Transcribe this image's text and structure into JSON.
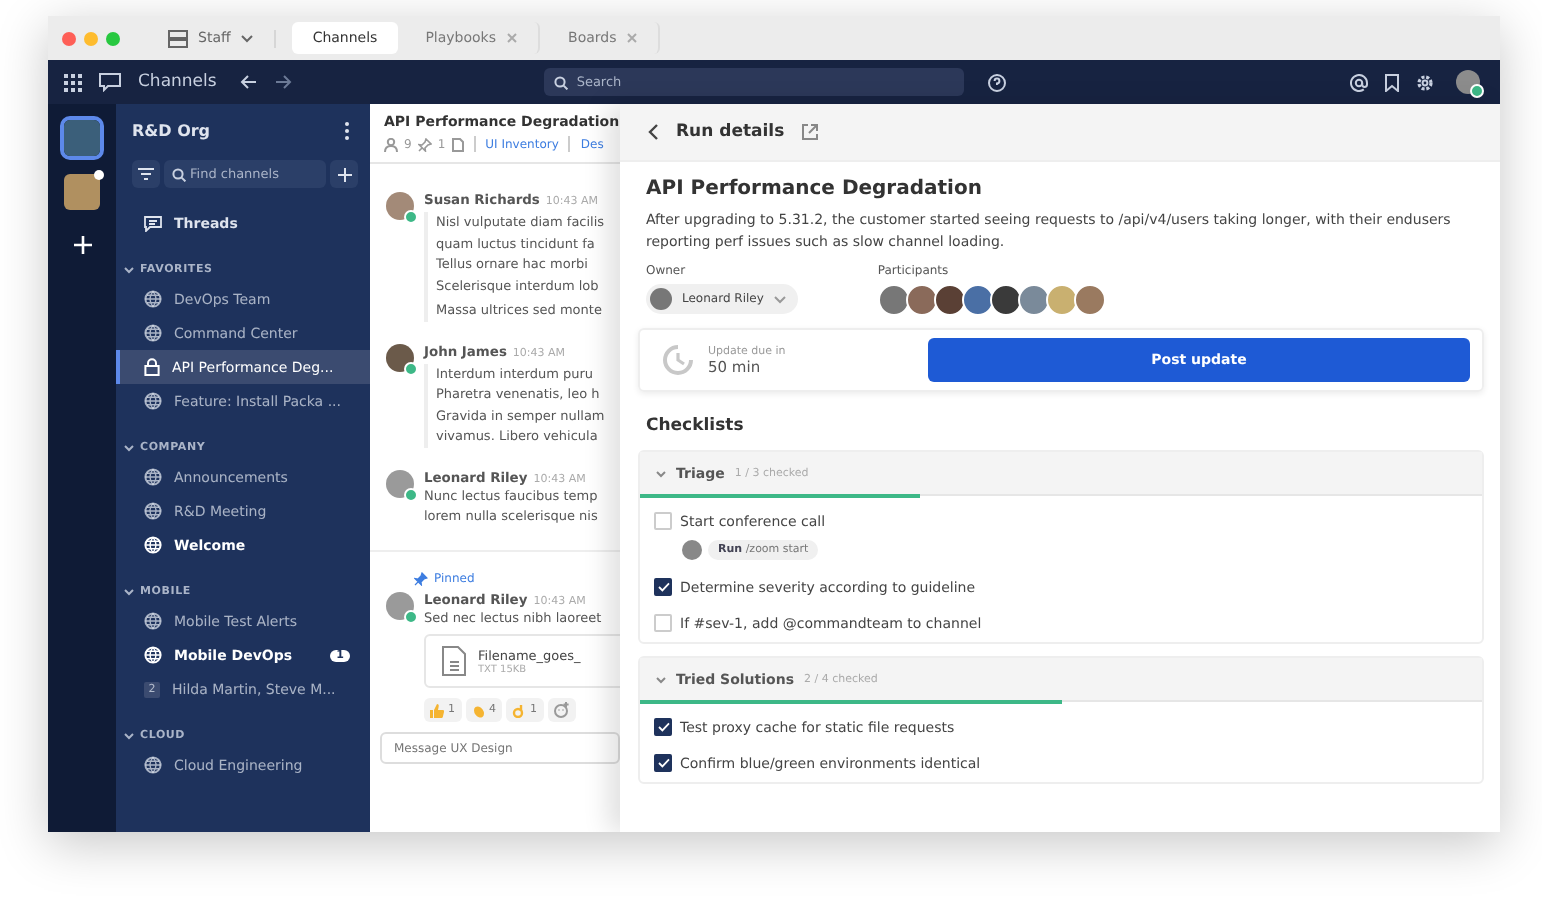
{
  "titlebar": {
    "workspace": "Staff",
    "tabs": [
      {
        "label": "Channels",
        "selected": true,
        "closable": false
      },
      {
        "label": "Playbooks",
        "selected": false,
        "closable": true
      },
      {
        "label": "Boards",
        "selected": false,
        "closable": true
      }
    ]
  },
  "nav": {
    "product": "Channels",
    "search": {
      "placeholder": "Search"
    }
  },
  "teams": [
    {
      "selected": true,
      "unread": false
    },
    {
      "selected": false,
      "unread": true
    }
  ],
  "sidebar": {
    "team_name": "R&D Org",
    "filter": {
      "placeholder": "Find channels"
    },
    "threads": "Threads",
    "sections": [
      {
        "title": "FAVORITES",
        "items": [
          {
            "kind": "public",
            "label": "DevOps Team",
            "selected": false,
            "unread": false
          },
          {
            "kind": "public",
            "label": "Command Center",
            "selected": false,
            "unread": false
          },
          {
            "kind": "private",
            "label": "API Performance Deg...",
            "selected": true,
            "unread": false
          },
          {
            "kind": "public",
            "label": "Feature: Install Packa ...",
            "selected": false,
            "unread": false
          }
        ]
      },
      {
        "title": "COMPANY",
        "items": [
          {
            "kind": "public",
            "label": "Announcements",
            "selected": false,
            "unread": false
          },
          {
            "kind": "public",
            "label": "R&D Meeting",
            "selected": false,
            "unread": false
          },
          {
            "kind": "public",
            "label": "Welcome",
            "selected": false,
            "unread": true
          }
        ]
      },
      {
        "title": "MOBILE",
        "items": [
          {
            "kind": "public",
            "label": "Mobile Test Alerts",
            "selected": false,
            "unread": false
          },
          {
            "kind": "public",
            "label": "Mobile DevOps",
            "selected": false,
            "unread": true,
            "badge": "1"
          },
          {
            "kind": "group",
            "label": "Hilda Martin, Steve M...",
            "selected": false,
            "unread": false,
            "count": "2"
          }
        ]
      },
      {
        "title": "CLOUD",
        "items": [
          {
            "kind": "public",
            "label": "Cloud Engineering",
            "selected": false,
            "unread": false
          }
        ]
      }
    ]
  },
  "channel": {
    "title": "API Performance Degradation",
    "members": "9",
    "pinned": "1",
    "links": [
      "UI Inventory",
      "Des"
    ],
    "posts": [
      {
        "author": "Susan Richards",
        "time": "10:43 AM",
        "quoted": true,
        "paragraphs": [
          [
            "Nisl vulputate diam facilis",
            "quam luctus tincidunt fa",
            "Tellus ornare hac morbi",
            "Scelerisque interdum lob"
          ],
          [
            "Massa ultrices sed monte"
          ]
        ]
      },
      {
        "author": "John James",
        "time": "10:43 AM",
        "quoted": true,
        "paragraphs": [
          [
            "Interdum interdum puru",
            "Pharetra venenatis, leo h",
            "Gravida in semper nullam",
            "vivamus. Libero vehicula"
          ]
        ]
      },
      {
        "author": "Leonard Riley",
        "time": "10:43 AM",
        "quoted": false,
        "paragraphs": [
          [
            "Nunc lectus faucibus temp",
            "lorem nulla scelerisque nis"
          ]
        ]
      }
    ],
    "pinned_post": {
      "label": "Pinned",
      "author": "Leonard Riley",
      "time": "10:43 AM",
      "text": "Sed nec lectus nibh laoreet",
      "file": {
        "name": "Filename_goes_",
        "meta": "TXT 15KB"
      },
      "reactions": [
        {
          "kind": "thumbs",
          "count": "1"
        },
        {
          "kind": "clap",
          "count": "4"
        },
        {
          "kind": "ok",
          "count": "1"
        }
      ]
    },
    "composer": {
      "placeholder": "Message UX Design"
    }
  },
  "run": {
    "header": "Run details",
    "title": "API Performance Degradation",
    "description": "After upgrading to 5.31.2, the customer started seeing requests to /api/v4/users taking longer, with their endusers reporting perf issues such as slow channel loading.",
    "owner_label": "Owner",
    "owner": "Leonard Riley",
    "participants_label": "Participants",
    "update_label": "Update due in",
    "update_time": "50 min",
    "post_button": "Post update",
    "checklists_title": "Checklists",
    "checklists": [
      {
        "name": "Triage",
        "progress": "1 / 3 checked",
        "level": 0.333,
        "items": [
          {
            "text": "Start conference call",
            "checked": false,
            "command": {
              "label": "Run",
              "value": "/zoom start"
            }
          },
          {
            "text": "Determine severity according to guideline",
            "checked": true
          },
          {
            "text": "If #sev-1, add @commandteam to channel",
            "checked": false
          }
        ]
      },
      {
        "name": "Tried Solutions",
        "progress": "2 / 4 checked",
        "level": 0.5,
        "items": [
          {
            "text": "Test proxy cache for static file requests",
            "checked": true
          },
          {
            "text": "Confirm blue/green environments identical",
            "checked": true
          }
        ]
      }
    ]
  }
}
